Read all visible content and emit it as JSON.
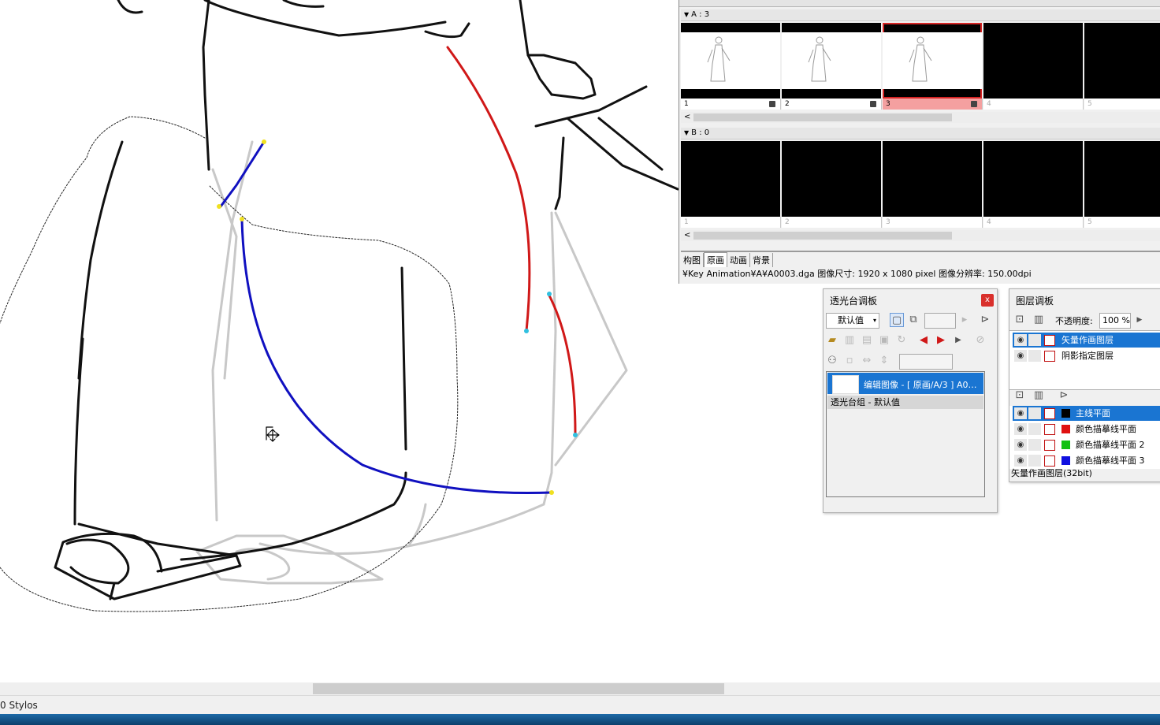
{
  "timeline": {
    "track_a": {
      "label": "A : 3",
      "frames": [
        {
          "num": "1",
          "filled": true
        },
        {
          "num": "2",
          "filled": true
        },
        {
          "num": "3",
          "filled": true,
          "selected": true
        },
        {
          "num": "4",
          "filled": false
        },
        {
          "num": "5",
          "filled": false
        }
      ]
    },
    "track_b": {
      "label": "B : 0",
      "frames": [
        {
          "num": "1"
        },
        {
          "num": "2"
        },
        {
          "num": "3"
        },
        {
          "num": "4"
        },
        {
          "num": "5"
        }
      ]
    },
    "tabs": [
      "构图",
      "原画",
      "动画",
      "背景"
    ],
    "active_tab": "原画",
    "path_info": "¥Key Animation¥A¥A0003.dga  图像尺寸: 1920 x 1080 pixel  图像分辨率: 150.00dpi"
  },
  "lighttable": {
    "title": "透光台调板",
    "close": "x",
    "preset": "默认值",
    "item_label": "编辑图像 - [ 原画/A/3 ] A0…",
    "group_label": "透光台组 - 默认值"
  },
  "layers": {
    "title": "图层调板",
    "opacity_label": "不透明度:",
    "opacity_value": "100 %",
    "top_layers": [
      {
        "name": "矢量作画图层",
        "selected": true
      },
      {
        "name": "阴影指定图层",
        "selected": false
      }
    ],
    "planes": [
      {
        "name": "主线平面",
        "color": "#000000",
        "selected": true
      },
      {
        "name": "颜色描摹线平面",
        "color": "#e01010",
        "selected": false
      },
      {
        "name": "颜色描摹线平面 2",
        "color": "#10c010",
        "selected": false
      },
      {
        "name": "颜色描摹线平面 3",
        "color": "#1010e0",
        "selected": false
      }
    ],
    "status": "矢量作画图层(32bit)"
  },
  "status_bar": {
    "text": "0 Stylos"
  },
  "colors": {
    "accent": "#1a75d2",
    "red_line": "#d01818",
    "blue_line": "#1010c0",
    "selected_frame": "#f4a0a0"
  }
}
